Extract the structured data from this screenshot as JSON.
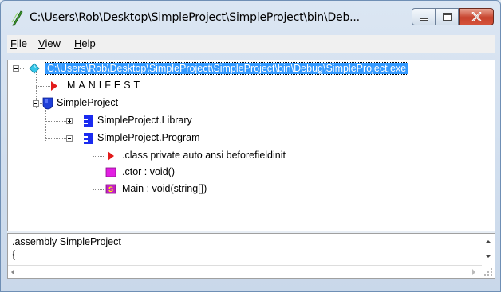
{
  "window": {
    "title": "C:\\Users\\Rob\\Desktop\\SimpleProject\\SimpleProject\\bin\\Deb...",
    "minimize_icon": "minimize-icon",
    "maximize_icon": "maximize-icon",
    "close_icon": "close-icon"
  },
  "menu": {
    "file": {
      "label": "File",
      "accel": "F",
      "rest": "ile"
    },
    "view": {
      "label": "View",
      "accel": "V",
      "rest": "iew"
    },
    "help": {
      "label": "Help",
      "accel": "H",
      "rest": "elp"
    }
  },
  "tree": {
    "root": {
      "label": "C:\\Users\\Rob\\Desktop\\SimpleProject\\SimpleProject\\bin\\Debug\\SimpleProject.exe",
      "icon": "diamond-icon",
      "color": "#35c6e8"
    },
    "manifest": {
      "label": "MANIFEST",
      "icon": "red-triangle-icon"
    },
    "namespace": {
      "label": "SimpleProject",
      "icon": "namespace-shield-icon",
      "color": "#1f3fd8"
    },
    "library": {
      "label": "SimpleProject.Library",
      "icon": "class-icon",
      "color": "#1a2bf0"
    },
    "program": {
      "label": "SimpleProject.Program",
      "icon": "class-icon",
      "color": "#1a2bf0"
    },
    "class_info": {
      "label": ".class private auto ansi beforefieldinit",
      "icon": "red-triangle-icon"
    },
    "ctor": {
      "label": ".ctor : void()",
      "icon": "method-icon",
      "color": "#e21fe2"
    },
    "main": {
      "label": "Main : void(string[])",
      "icon": "static-method-icon",
      "badge": "S",
      "color": "#c21fc2"
    }
  },
  "detail": {
    "line1": ".assembly SimpleProject",
    "line2": "{"
  }
}
